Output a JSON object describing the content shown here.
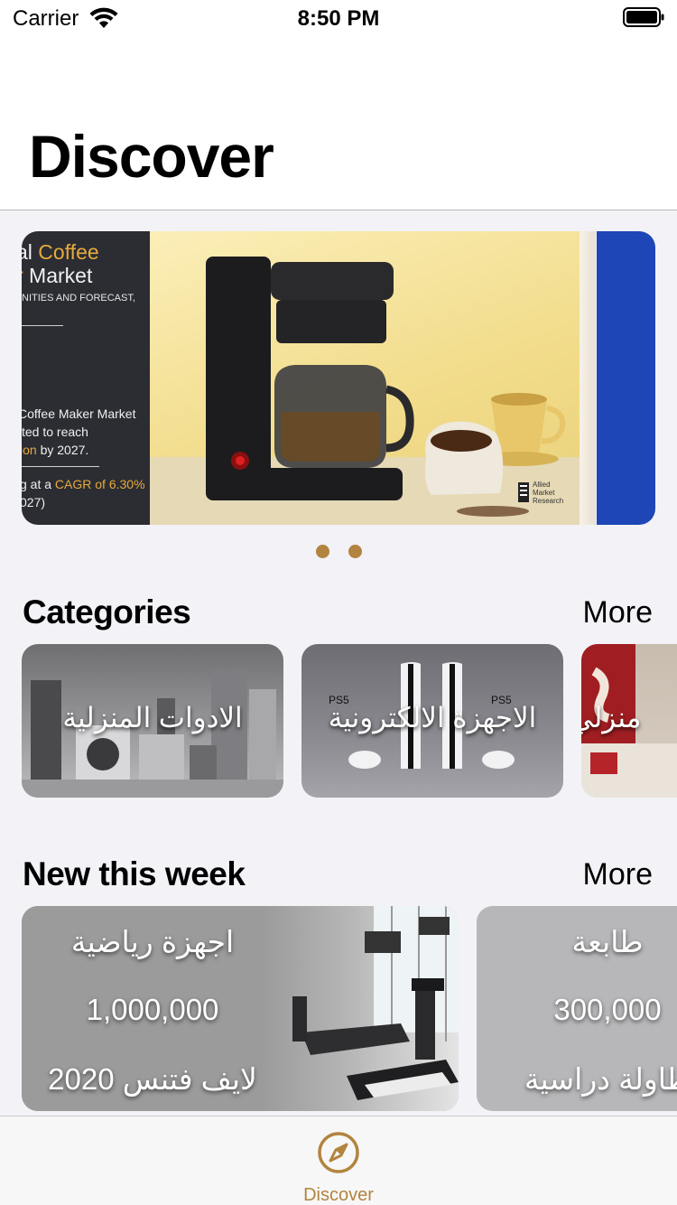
{
  "status_bar": {
    "carrier": "Carrier",
    "time": "8:50 PM"
  },
  "header": {
    "title": "Discover"
  },
  "banner": {
    "slides": [
      {
        "title_line1": "al ",
        "title_line1_accent": "Coffee",
        "title_line2_accent": "r",
        "title_line2": " Market",
        "subtitle": "NITIES AND FORECAST,",
        "text_line1": "Coffee Maker Market",
        "text_line2": "ted to reach",
        "text_line3_accent": "ion",
        "text_line3": " by 2027.",
        "text_line4": "g at a ",
        "text_line4_accent": "CAGR of 6.30%",
        "text_line5": "027)",
        "logo_text": "Allied\nMarket\nResearch"
      }
    ],
    "page_count": 2,
    "current_page": 0
  },
  "categories": {
    "title": "Categories",
    "more_label": "More",
    "items": [
      {
        "label": "الادوات المنزلية"
      },
      {
        "label": "الاجهزة الالكترونية"
      },
      {
        "label": "منزلي"
      }
    ]
  },
  "new_this_week": {
    "title": "New this week",
    "more_label": "More",
    "items": [
      {
        "name": "اجهزة رياضية",
        "price": "1,000,000",
        "subtitle": "لايف فتنس 2020"
      },
      {
        "name": "طابعة",
        "price": "300,000",
        "subtitle": "طاولة دراسية"
      }
    ]
  },
  "tab_bar": {
    "tabs": [
      {
        "label": "Discover",
        "icon": "compass-icon",
        "selected": true
      }
    ],
    "accent_color": "#b3843f"
  }
}
